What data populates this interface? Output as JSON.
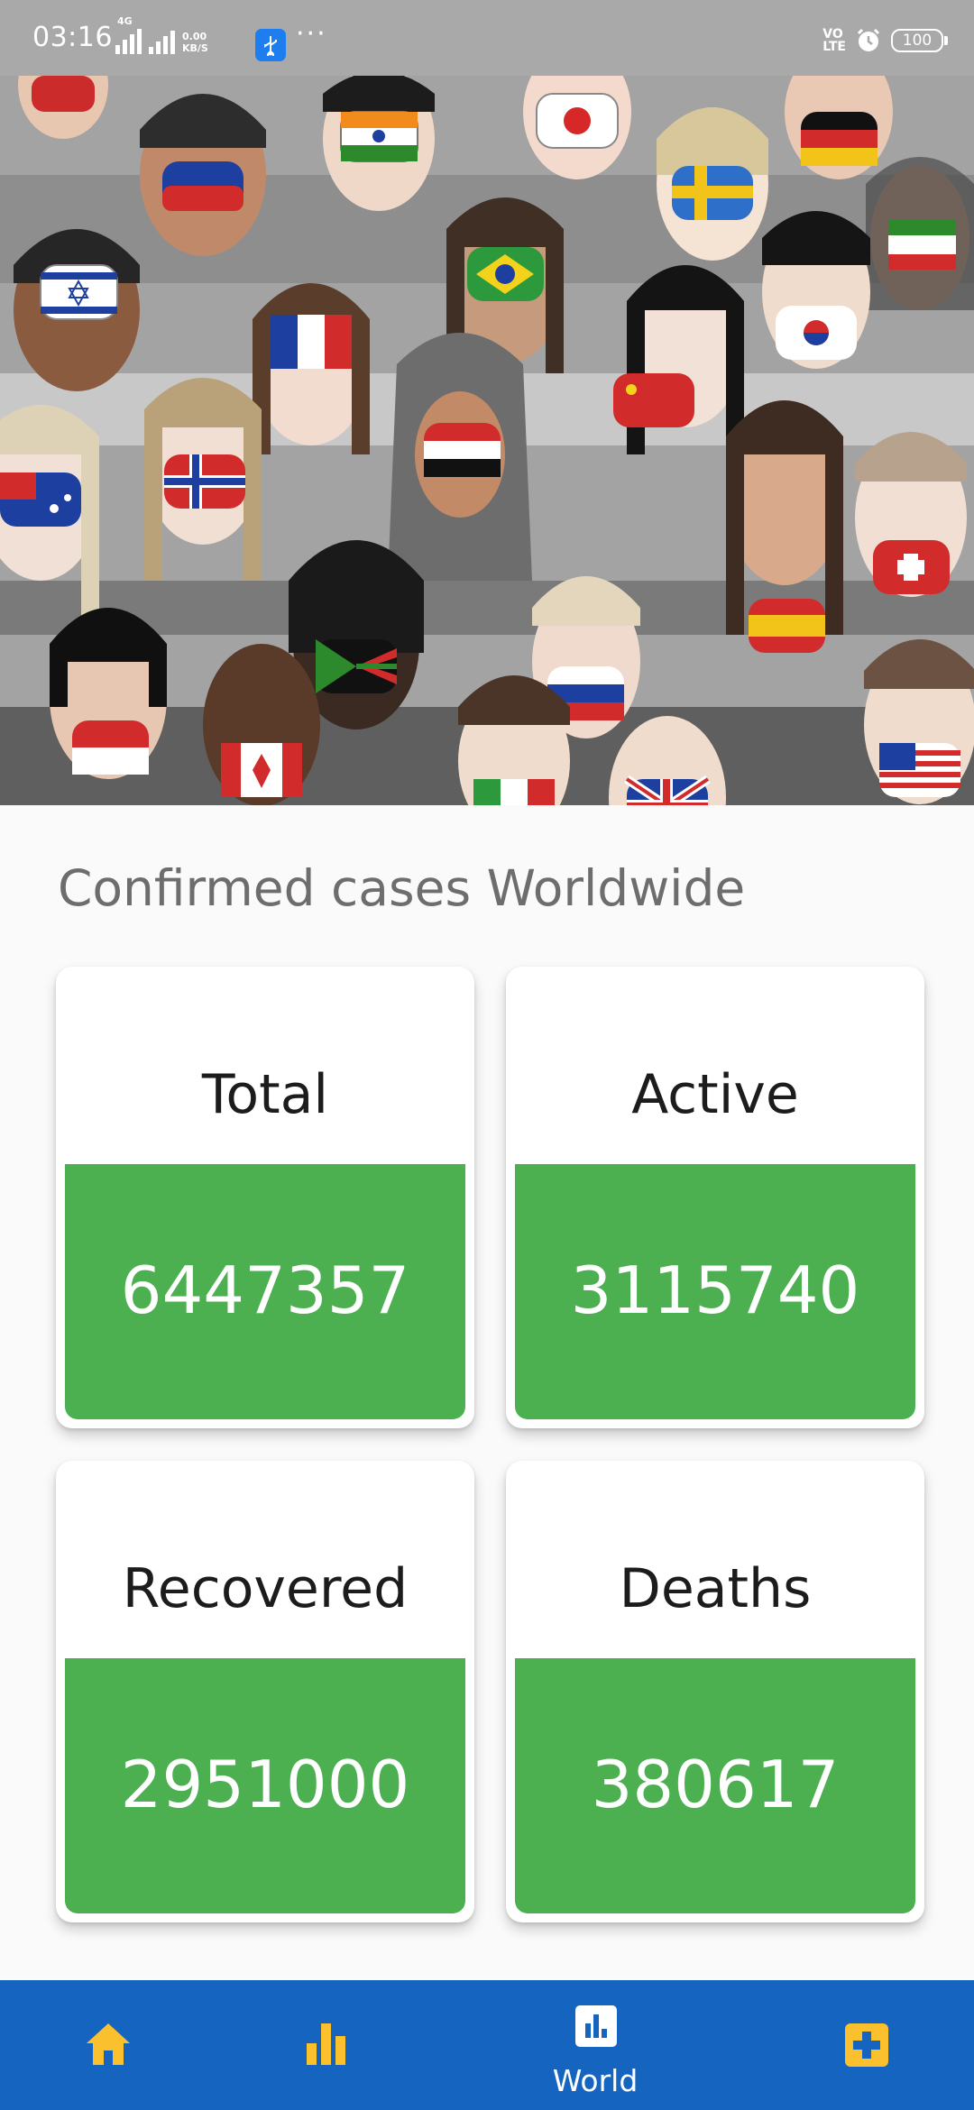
{
  "status_bar": {
    "time": "03:16",
    "network_label": "4G",
    "speed_value": "0.00",
    "speed_unit": "KB/S",
    "more": "···",
    "volte_top": "VO",
    "volte_bottom": "LTE",
    "battery": "100"
  },
  "banner": {
    "icon": "people-wearing-flag-masks-illustration"
  },
  "main": {
    "title": "Confirmed cases Worldwide",
    "cards": [
      {
        "label": "Total",
        "value": "6447357"
      },
      {
        "label": "Active",
        "value": "3115740"
      },
      {
        "label": "Recovered",
        "value": "2951000"
      },
      {
        "label": "Deaths",
        "value": "380617"
      }
    ]
  },
  "bottom_nav": {
    "items": [
      {
        "icon": "home-icon",
        "label": ""
      },
      {
        "icon": "bar-chart-icon",
        "label": ""
      },
      {
        "icon": "chart-box-icon",
        "label": "World"
      },
      {
        "icon": "plus-box-icon",
        "label": ""
      }
    ],
    "active_index": 2
  },
  "colors": {
    "status_bar": "#a9a9a9",
    "card_value_bg": "#4caf50",
    "nav_bg": "#1565c0",
    "nav_icon_inactive": "#fbc02d",
    "nav_icon_active": "#ffffff",
    "title_text": "#6d6d6d"
  }
}
